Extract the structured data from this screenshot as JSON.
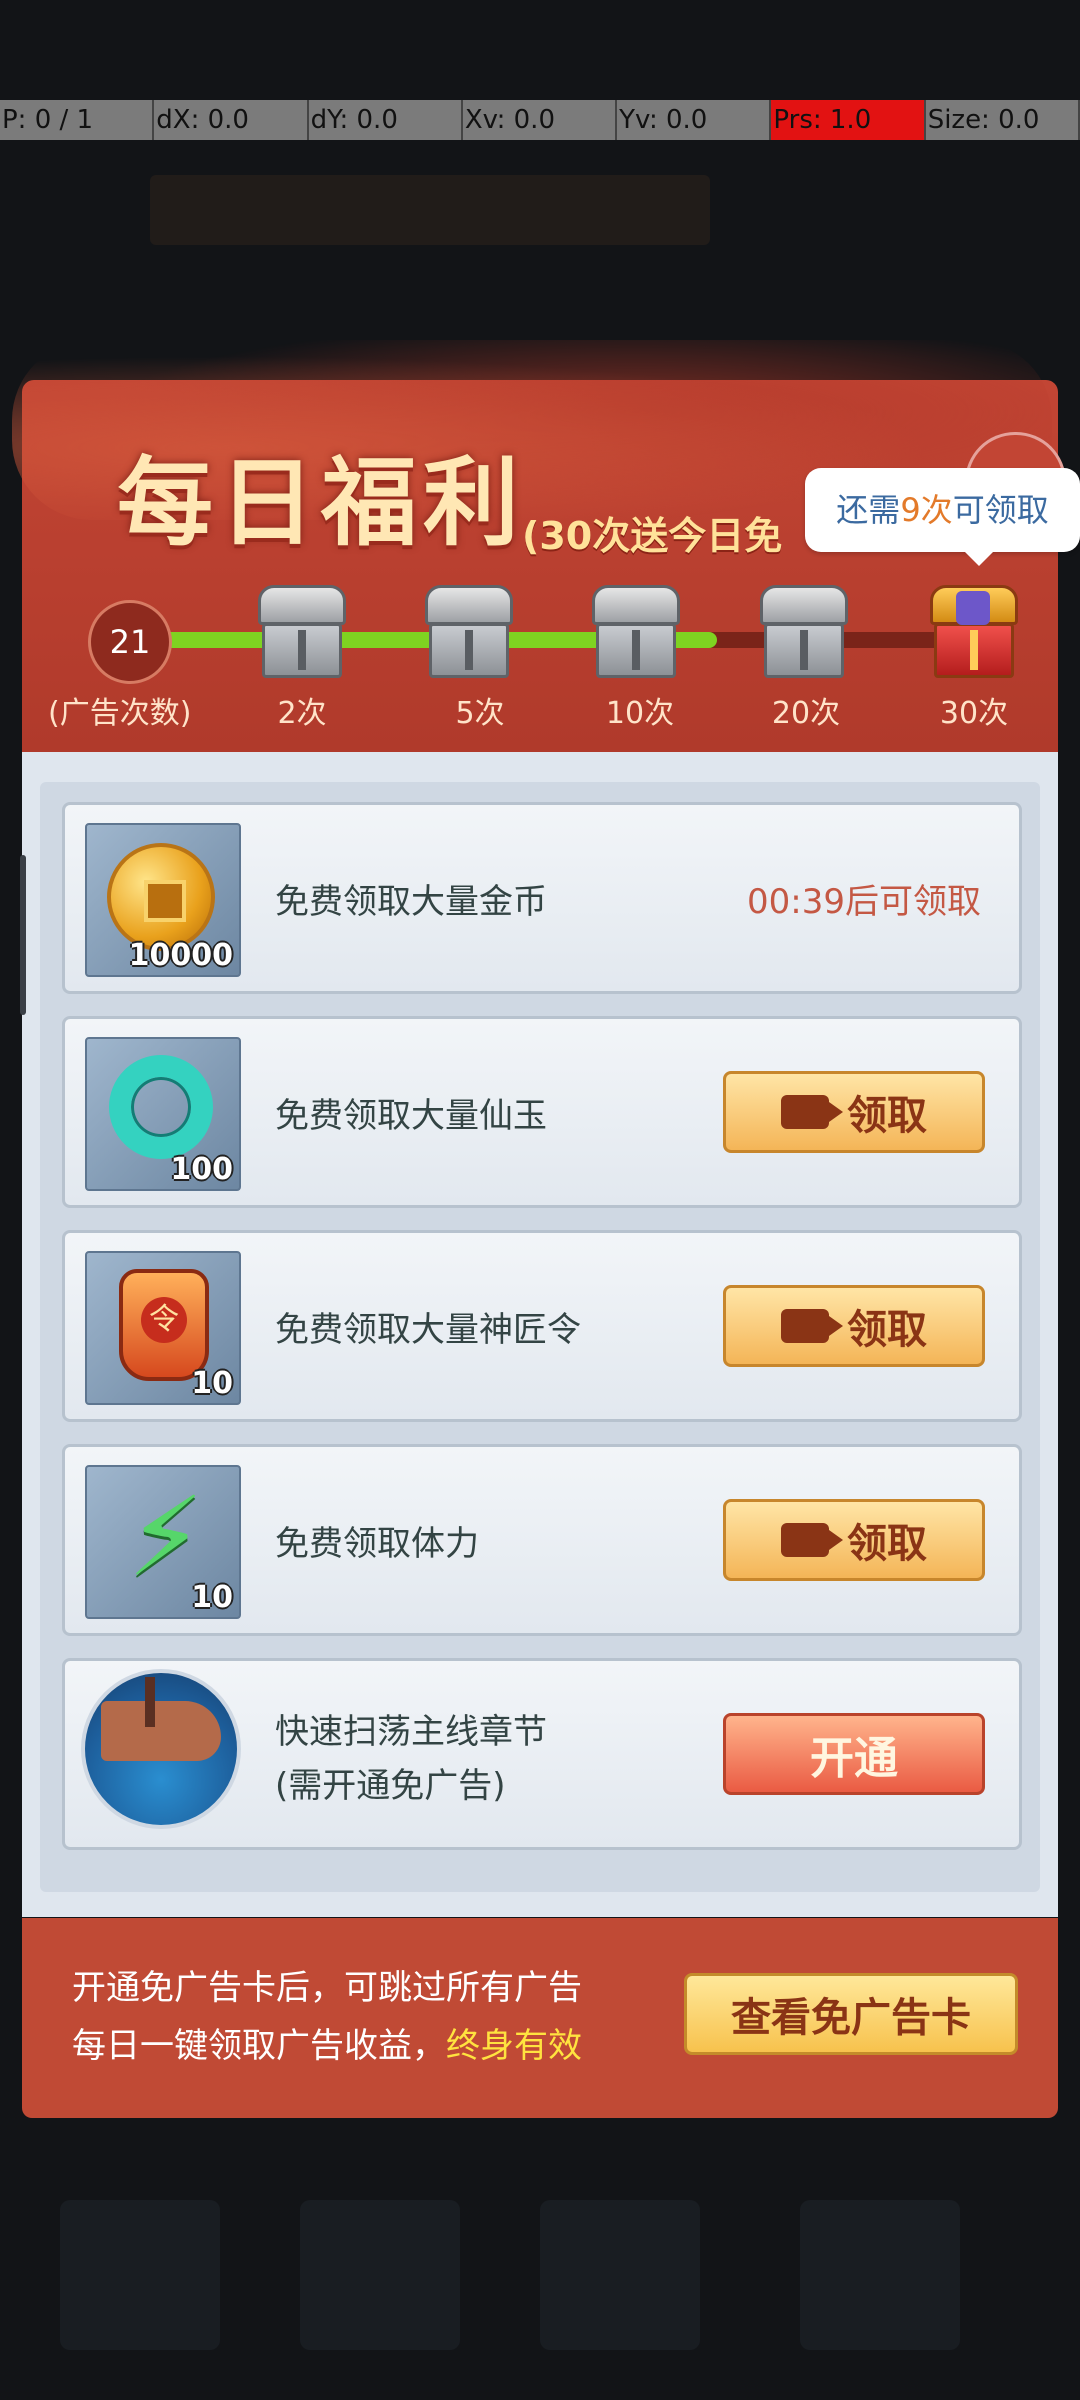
{
  "debug": {
    "p": "P: 0 / 1",
    "dx": "dX: 0.0",
    "dy": "dY: 0.0",
    "xv": "Xv: 0.0",
    "yv": "Yv: 0.0",
    "prs": "Prs: 1.0",
    "size": "Size: 0.0"
  },
  "header": {
    "title": "每日福利",
    "subtitle": "(30次送今日免"
  },
  "tooltip": {
    "prefix": "还需",
    "count": "9次",
    "suffix": "可领取"
  },
  "progress": {
    "current": "21",
    "label": "(广告次数)",
    "fill_fraction": 0.7,
    "steps": [
      "2次",
      "5次",
      "10次",
      "20次",
      "30次"
    ]
  },
  "rewards": [
    {
      "text": "免费领取大量金币",
      "qty": "10000",
      "timer": "00:39后可领取",
      "icon": "gold-coin-icon"
    },
    {
      "text": "免费领取大量仙玉",
      "qty": "100",
      "button": "领取",
      "icon": "jade-dragon-icon"
    },
    {
      "text": "免费领取大量神匠令",
      "qty": "10",
      "button": "领取",
      "icon": "craft-token-icon"
    },
    {
      "text": "免费领取体力",
      "qty": "10",
      "button": "领取",
      "icon": "lightning-icon"
    },
    {
      "line1": "快速扫荡主线章节",
      "line2": "(需开通免广告)",
      "button": "开通",
      "icon": "dragon-ship-icon"
    }
  ],
  "footer": {
    "line1": "开通免广告卡后，可跳过所有广告",
    "line2_prefix": "每日一键领取广告收益，",
    "line2_highlight": "终身有效",
    "button": "查看免广告卡"
  }
}
